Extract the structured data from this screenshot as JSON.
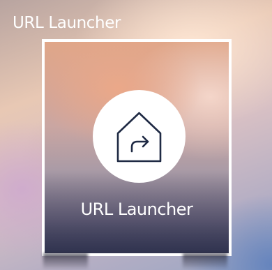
{
  "app": {
    "title": "URL Launcher"
  },
  "tile": {
    "label": "URL Launcher",
    "icon": "house-with-share-arrow-icon",
    "selected": true
  },
  "colors": {
    "tile_border": "#ffffff",
    "icon_stroke": "#1f2a44",
    "text": "#ffffff"
  }
}
